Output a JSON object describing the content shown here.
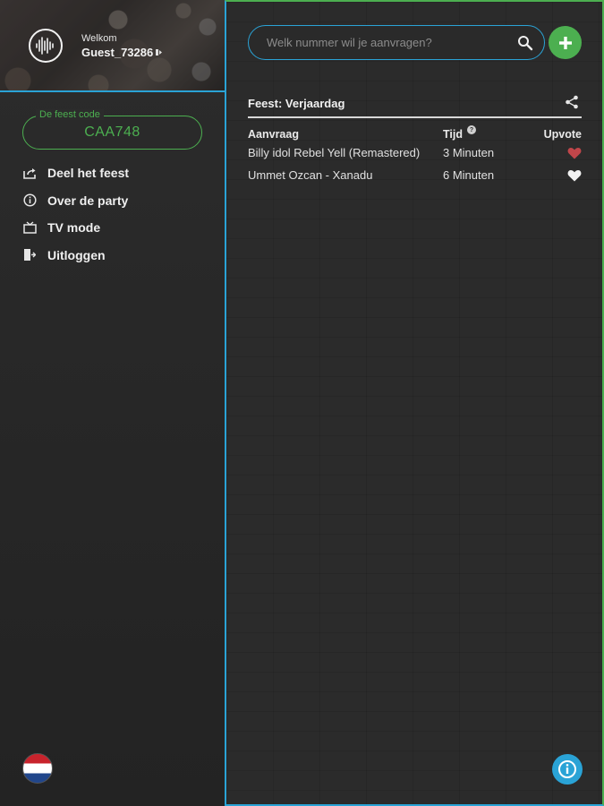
{
  "sidebar": {
    "welcome_label": "Welkom",
    "username": "Guest_73286",
    "code_legend": "De feest code",
    "code_value": "CAA748",
    "menu": [
      {
        "label": "Deel het feest",
        "icon": "share-out-icon"
      },
      {
        "label": "Over de party",
        "icon": "info-circle-icon"
      },
      {
        "label": "TV mode",
        "icon": "tv-icon"
      },
      {
        "label": "Uitloggen",
        "icon": "logout-icon"
      }
    ],
    "language_flag": "netherlands-flag"
  },
  "main": {
    "search_placeholder": "Welk nummer wil je aanvragen?",
    "party_title": "Feest: Verjaardag",
    "columns": {
      "request": "Aanvraag",
      "time": "Tijd",
      "upvote": "Upvote"
    },
    "rows": [
      {
        "request": "Billy idol Rebel Yell (Remastered)",
        "time": "3 Minuten",
        "upvoted": true
      },
      {
        "request": "Ummet Ozcan - Xanadu",
        "time": "6 Minuten",
        "upvoted": false
      }
    ]
  },
  "colors": {
    "accent_blue": "#2aa3d6",
    "accent_green": "#4caf50",
    "heart_upvoted": "#c0464a",
    "heart_default": "#f2f2f2"
  }
}
